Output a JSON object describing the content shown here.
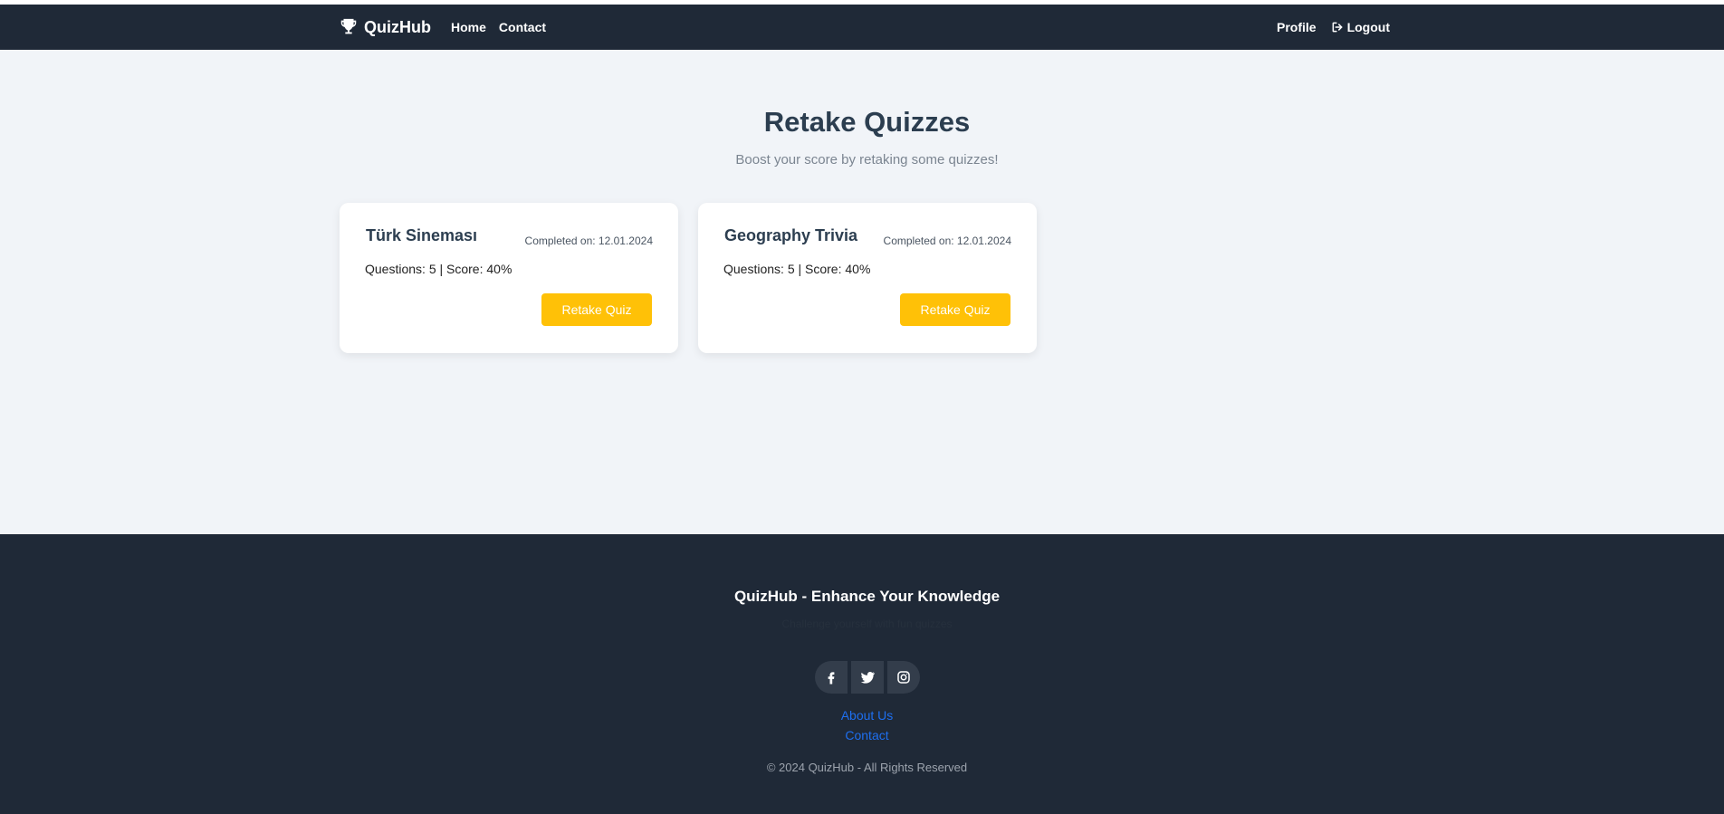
{
  "navbar": {
    "brand": "QuizHub",
    "brand_icon": "trophy-icon",
    "links": [
      "Home",
      "Contact"
    ],
    "profile": "Profile",
    "logout": "Logout",
    "logout_icon": "logout-icon"
  },
  "main": {
    "title": "Retake Quizzes",
    "subtitle": "Boost your score by retaking some quizzes!",
    "cards": [
      {
        "title": "Türk Sineması",
        "completed": "Completed on: 12.01.2024",
        "meta": "Questions: 5 | Score: 40%",
        "button": "Retake Quiz"
      },
      {
        "title": "Geography Trivia",
        "completed": "Completed on: 12.01.2024",
        "meta": "Questions: 5 | Score: 40%",
        "button": "Retake Quiz"
      }
    ]
  },
  "footer": {
    "title": "QuizHub - Enhance Your Knowledge",
    "tagline": "Challenge yourself with fun quizzes",
    "socials": [
      "facebook-icon",
      "twitter-icon",
      "instagram-icon"
    ],
    "about": "About Us",
    "contact": "Contact",
    "copyright": "© 2024 QuizHub - All Rights Reserved"
  },
  "colors": {
    "navbar_bg": "#1f2937",
    "page_bg": "#f1f4f8",
    "accent_button": "#ffc107",
    "link": "#1e6ff0"
  }
}
